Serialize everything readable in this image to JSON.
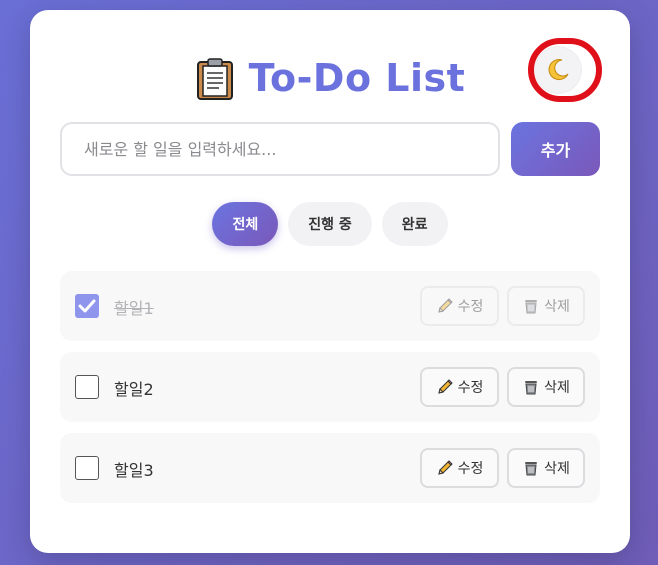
{
  "header": {
    "title": "To-Do List",
    "title_icon": "clipboard-icon"
  },
  "theme_toggle": {
    "icon": "crescent-moon-icon"
  },
  "new_todo": {
    "placeholder": "새로운 할 일을 입력하세요...",
    "value": ""
  },
  "add_button": {
    "label": "추가"
  },
  "filters": [
    {
      "label": "전체",
      "active": true
    },
    {
      "label": "진행 중",
      "active": false
    },
    {
      "label": "완료",
      "active": false
    }
  ],
  "todos": [
    {
      "text": "할일1",
      "done": true,
      "edit_label": "수정",
      "delete_label": "삭제"
    },
    {
      "text": "할일2",
      "done": false,
      "edit_label": "수정",
      "delete_label": "삭제"
    },
    {
      "text": "할일3",
      "done": false,
      "edit_label": "수정",
      "delete_label": "삭제"
    }
  ],
  "colors": {
    "accent_start": "#6b74e0",
    "accent_end": "#7a58b9",
    "title": "#6b72dd",
    "annotation_ring": "#e0101a"
  }
}
